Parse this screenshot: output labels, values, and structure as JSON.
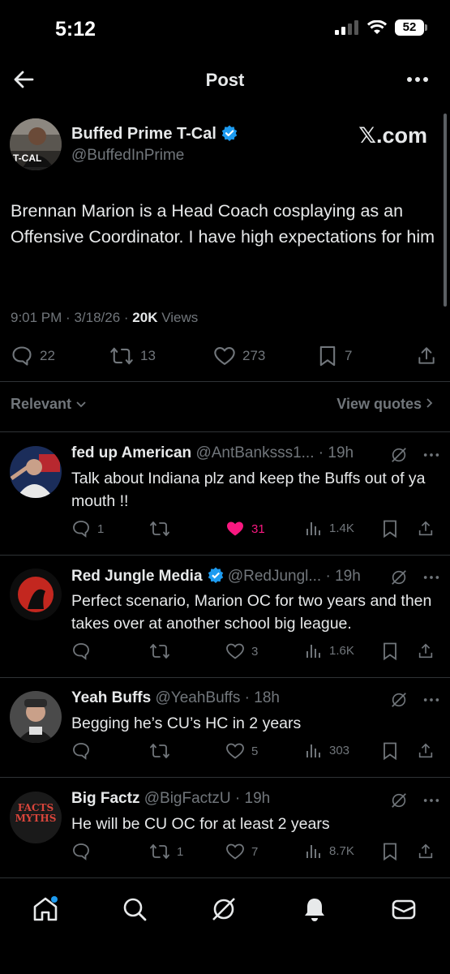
{
  "status": {
    "time": "5:12",
    "battery": "52"
  },
  "header": {
    "title": "Post"
  },
  "post": {
    "author_name": "Buffed Prime T-Cal",
    "handle": "@BuffedInPrime",
    "source_badge": "𝕏.com",
    "avatar_text": "T-CAL",
    "text": "Brennan Marion is a Head Coach cosplaying as an Offensive Coordinator. I have high expectations for him",
    "time": "9:01 PM",
    "date": "3/18/26",
    "views_count": "20K",
    "views_label": "Views",
    "replies": "22",
    "reposts": "13",
    "likes": "273",
    "bookmarks": "7"
  },
  "filter": {
    "label": "Relevant",
    "quotes_label": "View quotes"
  },
  "replies": [
    {
      "name": "fed up American",
      "handle": "@AntBanksss1...",
      "time": "19h",
      "text": "Talk about Indiana plz and keep the Buffs out of ya mouth !!",
      "reply_count": "1",
      "repost_count": "",
      "like_count": "31",
      "views": "1.4K",
      "liked": true,
      "verified": false
    },
    {
      "name": "Red Jungle Media",
      "handle": "@RedJungl...",
      "time": "19h",
      "text": "Perfect scenario, Marion OC for two years and then takes over at another school big league.",
      "reply_count": "",
      "repost_count": "",
      "like_count": "3",
      "views": "1.6K",
      "liked": false,
      "verified": true
    },
    {
      "name": "Yeah Buffs",
      "handle": "@YeahBuffs",
      "time": "18h",
      "text": "Begging he’s CU’s HC in 2 years",
      "reply_count": "",
      "repost_count": "",
      "like_count": "5",
      "views": "303",
      "liked": false,
      "verified": false
    },
    {
      "name": "Big Factz",
      "handle": "@BigFactzU",
      "time": "19h",
      "text": "He will be CU OC for at least 2 years",
      "reply_count": "",
      "repost_count": "1",
      "like_count": "7",
      "views": "8.7K",
      "liked": false,
      "verified": false,
      "avatar_text": "FACTS MYTHS"
    }
  ],
  "nav": {
    "items": [
      "home-icon",
      "search-icon",
      "grok-icon",
      "notifications-icon",
      "messages-icon"
    ]
  },
  "colors": {
    "accent": "#1d9bf0",
    "like": "#f91880",
    "muted": "#71767b",
    "text": "#e7e9ea",
    "divider": "#2f3336"
  }
}
